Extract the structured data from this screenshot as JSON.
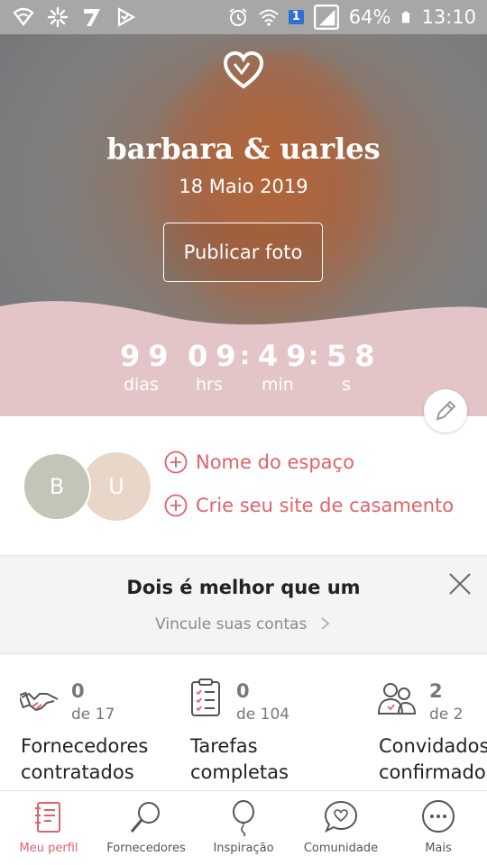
{
  "status_bar": {
    "sim_slot": "1",
    "battery": "64%",
    "time": "13:10"
  },
  "hero": {
    "couple_names": "barbara & uarles",
    "wedding_date": "18 Maio 2019",
    "publish_button": "Publicar foto"
  },
  "countdown": {
    "days": "99",
    "hours": "09",
    "minutes": "49",
    "seconds": "58",
    "separator": ":",
    "days_label": "dias",
    "hours_label": "hrs",
    "minutes_label": "min",
    "seconds_label": "s"
  },
  "profile": {
    "avatar_left": "B",
    "avatar_right": "U",
    "venue_link": "Nome do espaço",
    "site_link": "Crie seu site de casamento"
  },
  "promo": {
    "title": "Dois é melhor que um",
    "link": "Vincule suas contas"
  },
  "stats": [
    {
      "count": "0",
      "of": "de 17",
      "label_line1": "Fornecedores",
      "label_line2": "contratados",
      "icon": "handshake-icon"
    },
    {
      "count": "0",
      "of": "de 104",
      "label_line1": "Tarefas",
      "label_line2": "completas",
      "icon": "checklist-icon"
    },
    {
      "count": "2",
      "of": "de 2",
      "label_line1": "Convidados",
      "label_line2": "confirmados",
      "icon": "guests-icon"
    }
  ],
  "nav": [
    {
      "label": "Meu perfil",
      "icon": "notebook-icon",
      "active": true
    },
    {
      "label": "Fornecedores",
      "icon": "magnifier-icon",
      "active": false
    },
    {
      "label": "Inspiração",
      "icon": "balloon-icon",
      "active": false
    },
    {
      "label": "Comunidade",
      "icon": "chat-heart-icon",
      "active": false
    },
    {
      "label": "Mais",
      "icon": "more-icon",
      "active": false
    }
  ],
  "colors": {
    "accent": "#e0626a",
    "countdown_band": "#e3c4c7",
    "status_bar": "#a7a7a7"
  }
}
